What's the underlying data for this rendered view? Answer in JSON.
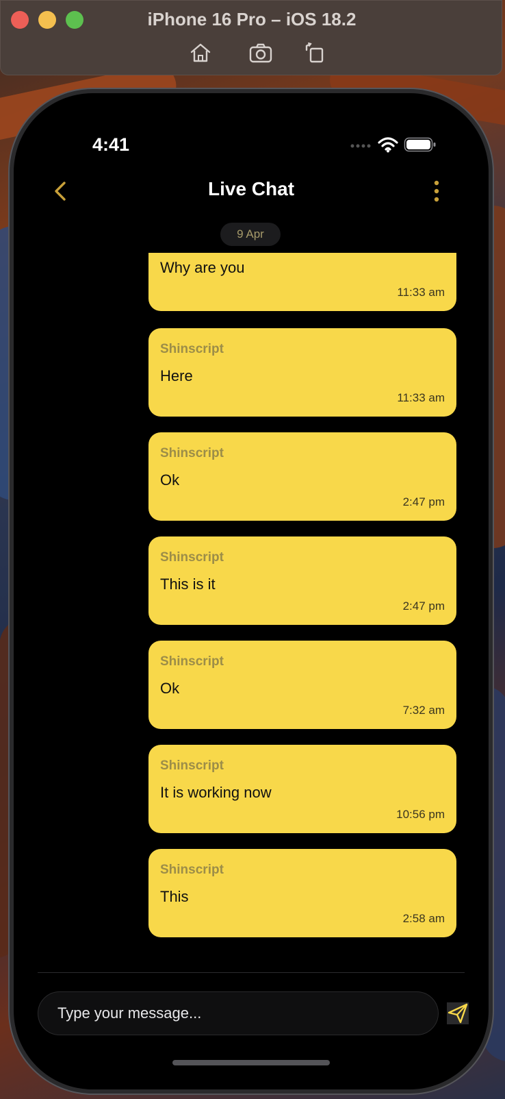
{
  "simulator": {
    "title": "iPhone 16 Pro – iOS 18.2",
    "toolbar_icons": [
      "home-icon",
      "screenshot-icon",
      "rotate-icon"
    ]
  },
  "status_bar": {
    "time": "4:41",
    "icons": [
      "signal-icon",
      "wifi-icon",
      "battery-icon"
    ]
  },
  "header": {
    "title": "Live Chat",
    "back_icon": "chevron-left-icon",
    "menu_icon": "more-vertical-icon"
  },
  "date_separator": "9 Apr",
  "messages": [
    {
      "sender": "",
      "text": "Why are you",
      "time": "11:33 am"
    },
    {
      "sender": "Shinscript",
      "text": "Here",
      "time": "11:33 am"
    },
    {
      "sender": "Shinscript",
      "text": "Ok",
      "time": "2:47 pm"
    },
    {
      "sender": "Shinscript",
      "text": "This is it",
      "time": "2:47 pm"
    },
    {
      "sender": "Shinscript",
      "text": "Ok",
      "time": "7:32 am"
    },
    {
      "sender": "Shinscript",
      "text": "It is working now",
      "time": "10:56 pm"
    },
    {
      "sender": "Shinscript",
      "text": "This",
      "time": "2:58 am"
    }
  ],
  "composer": {
    "placeholder": "Type your message...",
    "send_icon": "send-icon"
  },
  "colors": {
    "bubble": "#f8d84a",
    "accent": "#c9a13a",
    "background": "#000000"
  }
}
